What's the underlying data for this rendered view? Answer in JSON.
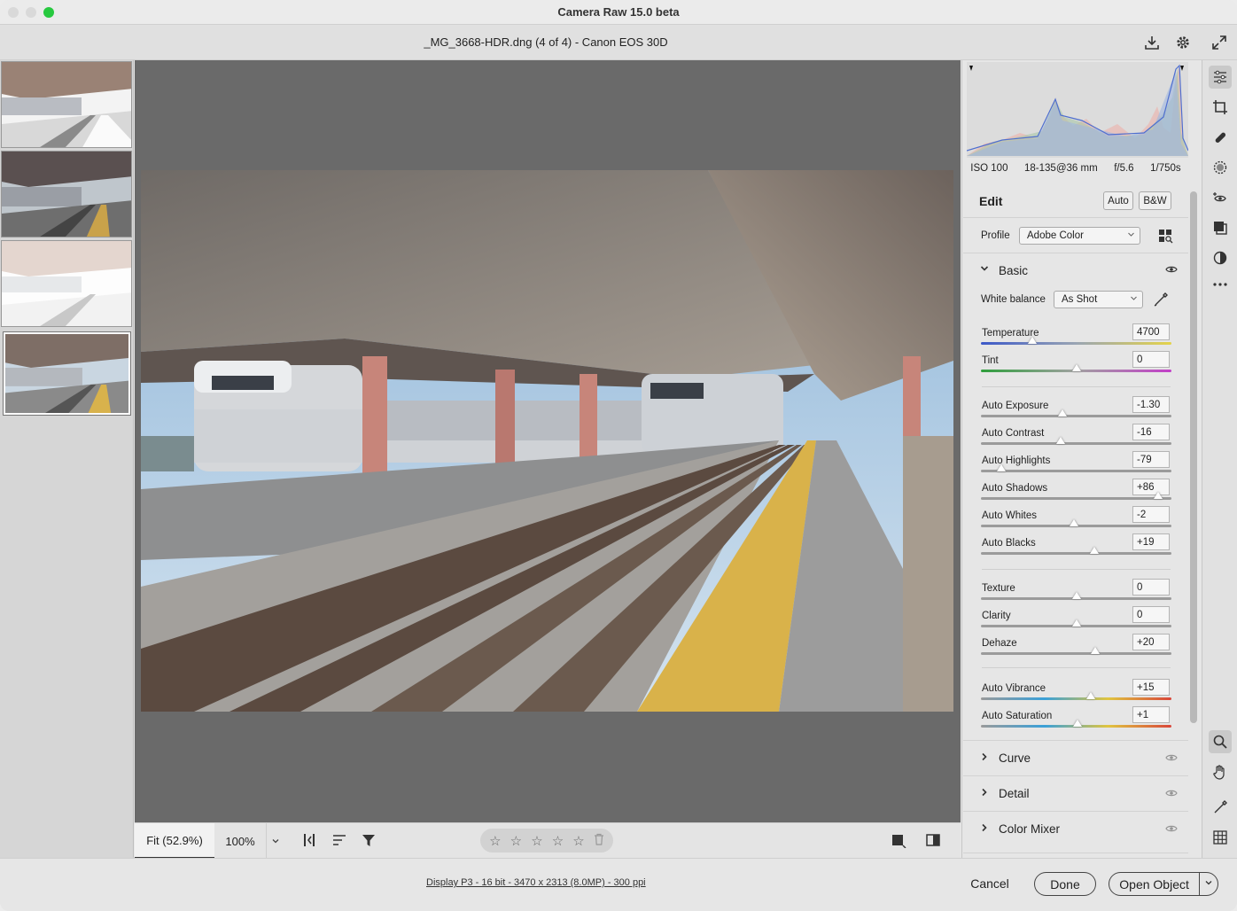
{
  "app_title": "Camera Raw 15.0 beta",
  "file_title": "_MG_3668-HDR.dng (4 of 4)  -  Canon EOS 30D",
  "header_icons": [
    "save-icon",
    "gear-icon",
    "fullscreen-icon"
  ],
  "exif": {
    "iso": "ISO 100",
    "lens": "18-135@36 mm",
    "aperture": "f/5.6",
    "shutter": "1/750s"
  },
  "edit": {
    "title": "Edit",
    "auto_label": "Auto",
    "bw_label": "B&W"
  },
  "profile": {
    "label": "Profile",
    "value": "Adobe Color"
  },
  "basic": {
    "title": "Basic",
    "white_balance_label": "White balance",
    "white_balance_value": "As Shot",
    "sliders": [
      {
        "label": "Temperature",
        "value": "4700",
        "pos": 0.27,
        "color": "temp"
      },
      {
        "label": "Tint",
        "value": "0",
        "pos": 0.5,
        "color": "tint"
      },
      {
        "label": "Auto Exposure",
        "value": "-1.30",
        "pos": 0.43
      },
      {
        "label": "Auto Contrast",
        "value": "-16",
        "pos": 0.42
      },
      {
        "label": "Auto Highlights",
        "value": "-79",
        "pos": 0.105
      },
      {
        "label": "Auto Shadows",
        "value": "+86",
        "pos": 0.93
      },
      {
        "label": "Auto Whites",
        "value": "-2",
        "pos": 0.49
      },
      {
        "label": "Auto Blacks",
        "value": "+19",
        "pos": 0.595
      },
      {
        "label": "Texture",
        "value": "0",
        "pos": 0.5
      },
      {
        "label": "Clarity",
        "value": "0",
        "pos": 0.5
      },
      {
        "label": "Dehaze",
        "value": "+20",
        "pos": 0.6
      },
      {
        "label": "Auto Vibrance",
        "value": "+15",
        "pos": 0.575,
        "color": "sat"
      },
      {
        "label": "Auto Saturation",
        "value": "+1",
        "pos": 0.505,
        "color": "sat"
      }
    ]
  },
  "collapsed_sections": [
    "Curve",
    "Detail",
    "Color Mixer"
  ],
  "preview_toolbar": {
    "zoom_fit": "Fit (52.9%)",
    "zoom_100": "100%"
  },
  "footer": {
    "workflow": "Display P3 - 16 bit - 3470 x 2313 (8.0MP) - 300 ppi",
    "cancel": "Cancel",
    "done": "Done",
    "open": "Open Object"
  },
  "colors": {
    "accent": "#27c93f",
    "panel": "#e6e6e6",
    "preview_bg": "#6a6a6a"
  }
}
